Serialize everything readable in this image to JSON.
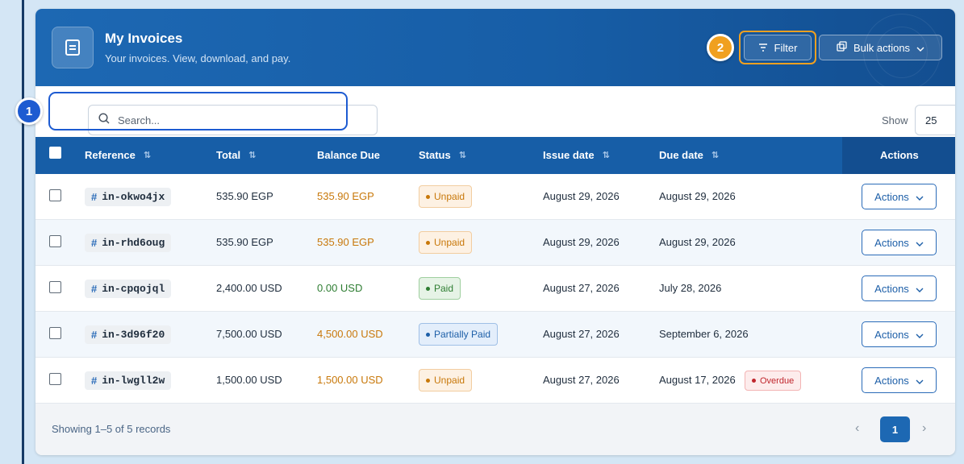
{
  "header": {
    "title": "My Invoices",
    "subtitle": "Your invoices. View, download, and pay.",
    "filter_label": "Filter",
    "bulk_label": "Bulk actions"
  },
  "markers": {
    "one": "1",
    "two": "2"
  },
  "search": {
    "placeholder": "Search..."
  },
  "page_size": {
    "label": "Show",
    "value": "25"
  },
  "columns": {
    "reference": "Reference",
    "total": "Total",
    "balance": "Balance Due",
    "status": "Status",
    "issue": "Issue date",
    "due": "Due date",
    "actions": "Actions"
  },
  "rows": [
    {
      "ref": "in-okwo4jx",
      "total": "535.90 EGP",
      "balance": "535.90 EGP",
      "status": "Unpaid",
      "issue": "August 29, 2026",
      "due": "August 29, 2026",
      "overdue": "",
      "action": "Actions"
    },
    {
      "ref": "in-rhd6oug",
      "total": "535.90 EGP",
      "balance": "535.90 EGP",
      "status": "Unpaid",
      "issue": "August 29, 2026",
      "due": "August 29, 2026",
      "overdue": "",
      "action": "Actions"
    },
    {
      "ref": "in-cpqojql",
      "total": "2,400.00 USD",
      "balance": "0.00 USD",
      "status": "Paid",
      "issue": "August 27, 2026",
      "due": "July 28, 2026",
      "overdue": "",
      "action": "Actions"
    },
    {
      "ref": "in-3d96f20",
      "total": "7,500.00 USD",
      "balance": "4,500.00 USD",
      "status": "Partially Paid",
      "issue": "August 27, 2026",
      "due": "September 6, 2026",
      "overdue": "",
      "action": "Actions"
    },
    {
      "ref": "in-lwgll2w",
      "total": "1,500.00 USD",
      "balance": "1,500.00 USD",
      "status": "Unpaid",
      "issue": "August 27, 2026",
      "due": "August 17, 2026",
      "overdue": "Overdue",
      "action": "Actions"
    }
  ],
  "footer": {
    "records": "Showing 1–5 of 5 records",
    "current_page": "1"
  },
  "colors": {
    "header_blue": "#175ea7",
    "accent_orange": "#f0a020",
    "marker_blue": "#1d5bd1",
    "unpaid_text": "#c8780a",
    "paid_text": "#2e7d32",
    "partial_text": "#1d5fa8",
    "overdue_red": "#c0262d"
  }
}
